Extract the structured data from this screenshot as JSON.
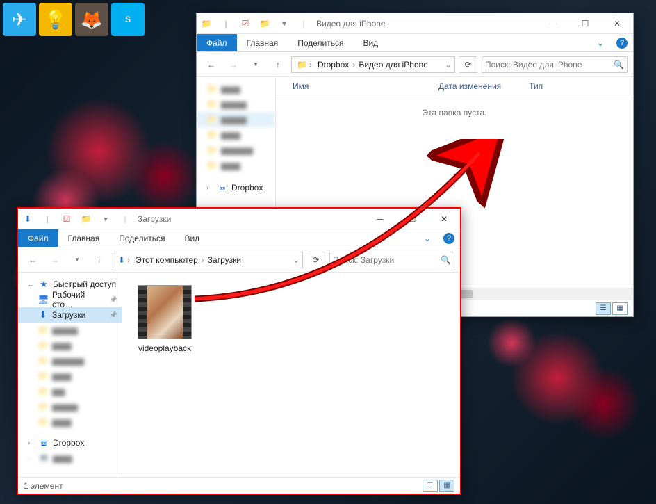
{
  "taskbar": {
    "icons": [
      "telegram",
      "lightbulb",
      "gimp",
      "skype"
    ]
  },
  "windowA": {
    "title": "Видео для iPhone",
    "ribbon": {
      "file": "Файл",
      "home": "Главная",
      "share": "Поделиться",
      "view": "Вид"
    },
    "breadcrumb": [
      "Dropbox",
      "Видео для iPhone"
    ],
    "search_placeholder": "Поиск: Видео для iPhone",
    "columns": {
      "name": "Имя",
      "date": "Дата изменения",
      "type": "Тип"
    },
    "empty_text": "Эта папка пуста.",
    "nav": {
      "dropbox": "Dropbox"
    }
  },
  "windowB": {
    "title": "Загрузки",
    "ribbon": {
      "file": "Файл",
      "home": "Главная",
      "share": "Поделиться",
      "view": "Вид"
    },
    "breadcrumb": [
      "Этот компьютер",
      "Загрузки"
    ],
    "search_placeholder": "Поиск: Загрузки",
    "nav": {
      "quick": "Быстрый доступ",
      "desktop": "Рабочий сто…",
      "downloads": "Загрузки",
      "dropbox": "Dropbox"
    },
    "file": {
      "name": "videoplayback"
    },
    "status": "1 элемент"
  }
}
